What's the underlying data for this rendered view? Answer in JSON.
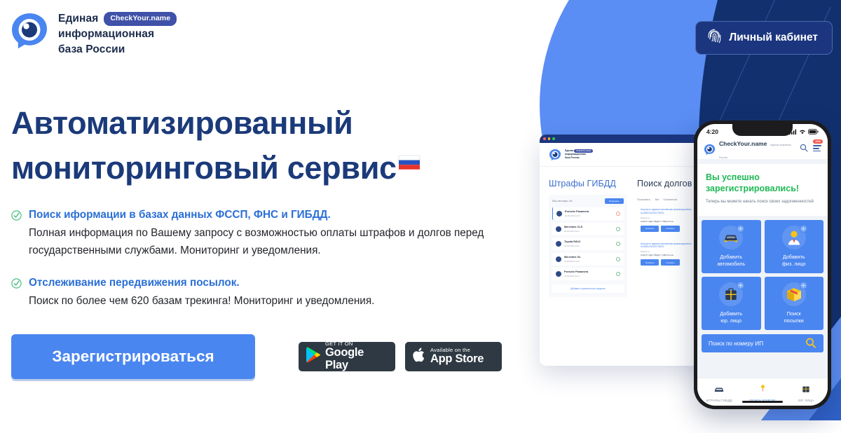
{
  "colors": {
    "brand_blue": "#4a86f0",
    "deep_navy": "#1b367f",
    "headline_navy": "#1b3a7a",
    "accent_green": "#1db954",
    "badge_purple": "#3f51a8",
    "light_blue": "#5b8ef4"
  },
  "header": {
    "logo": {
      "icon": "eye-speech-bubble-logo",
      "line1": "Единая",
      "badge": "CheckYour.name",
      "line2": "информационная",
      "line3": "база России"
    },
    "cabinet_button": {
      "label": "Личный кабинет",
      "icon": "fingerprint-icon"
    }
  },
  "hero": {
    "headline_line1": "Автоматизированный",
    "headline_line2": "мониторинговый сервис",
    "flag_icon": "russia-flag-icon",
    "features": [
      {
        "check_icon": "check-circle-icon",
        "title": "Поиск иформации в базах данных ФССП, ФНС и ГИБДД.",
        "description": "Полная информация по Вашему запросу с возможностью оплаты штрафов и долгов перед государственными службами. Мониторинг и уведомления."
      },
      {
        "check_icon": "check-circle-icon",
        "title": "Отслеживание передвижения посылок.",
        "description": "Поиск по более чем 620 базам трекинга! Мониторинг и уведомления."
      }
    ],
    "signup_button": "Зарегистрироваться",
    "store_badges": [
      {
        "icon": "google-play-icon",
        "small": "GET IT ON",
        "big": "Google Play"
      },
      {
        "icon": "apple-icon",
        "small": "Available on the",
        "big": "App Store"
      }
    ]
  },
  "desktop_mockup": {
    "window_dots": [
      "#ff5f57",
      "#febc2e",
      "#28c840"
    ],
    "logo": {
      "line1": "Единая",
      "badge": "CheckYour.name",
      "line2": "информационная",
      "line3": "база России"
    },
    "left_column": {
      "title": "Штрафы ГИБДД",
      "toolbar_label": "Ваш автопарк: 4/5",
      "check_button": "Проверить",
      "rows": [
        {
          "name": "Porsche Panamera",
          "date": "24.06.2019 14:21",
          "status": "red"
        },
        {
          "name": "Mercedes CLS",
          "date": "24.06.2019 14:21",
          "status": "green"
        },
        {
          "name": "Toyota RAV4",
          "date": "24.06.2019 14:21",
          "status": "green"
        },
        {
          "name": "Mercedes GL",
          "date": "24.06.2019 14:21",
          "status": "green"
        },
        {
          "name": "Porsche Panamera",
          "date": "24.06.2019 14:21",
          "status": "green"
        }
      ],
      "add_button": "Добавить транспортное средство"
    },
    "right_column": {
      "title": "Поиск долгов",
      "filter_label": "Показывать:",
      "filters": [
        "Все",
        "Оплаченные"
      ],
      "debts": [
        {
          "title": "Штраф по административному правонарушению №18810152190739024",
          "sub_label": "Реквизиты:",
          "code": "ЦАФАП ОДД ГИБДД ГУ МВД России",
          "buttons": [
            "Оплатить",
            "Оспорить"
          ]
        },
        {
          "title": "Штраф по административному правонарушению №18810152190739024",
          "sub_label": "Реквизиты:",
          "code": "ЦАФАП ОДД ГИБДД ГУ МВД России",
          "buttons": [
            "Оплатить",
            "Оспорить"
          ]
        }
      ]
    }
  },
  "phone_mockup": {
    "status_bar": {
      "time": "4:20",
      "icons": [
        "signal-icon",
        "wifi-icon",
        "battery-icon"
      ]
    },
    "app_header": {
      "logo_icon": "eye-speech-bubble-logo",
      "brand": "CheckYour.name",
      "brand_sub": "Единая инфобаза России",
      "search_icon": "search-icon",
      "menu_icon": "hamburger-menu-icon",
      "badge": "1020"
    },
    "success": {
      "title": "Вы успешно зарегистрировались!",
      "subtitle": "Теперь вы можете начать поиск своих задолженностей"
    },
    "tiles": [
      {
        "icon": "car-icon",
        "label": "Добавить\nавтомобиль"
      },
      {
        "icon": "person-icon",
        "label": "Добавить\nфиз. лицо"
      },
      {
        "icon": "briefcase-icon",
        "label": "Добавить\nюр. лицо"
      },
      {
        "icon": "parcel-box-icon",
        "label": "Поиск\nпосылки"
      }
    ],
    "search_bar": {
      "label": "Поиск по номеру ИП",
      "icon": "magnifier-icon"
    },
    "bottom_nav": [
      {
        "icon": "car-icon",
        "label": "ШТРАФЫ ГИБДД",
        "active": false
      },
      {
        "icon": "person-pin-icon",
        "label": "ПОИСК ДОЛГОВ",
        "active": true
      },
      {
        "icon": "briefcase-icon",
        "label": "ЮР. ЛИЦА",
        "active": false
      }
    ]
  }
}
